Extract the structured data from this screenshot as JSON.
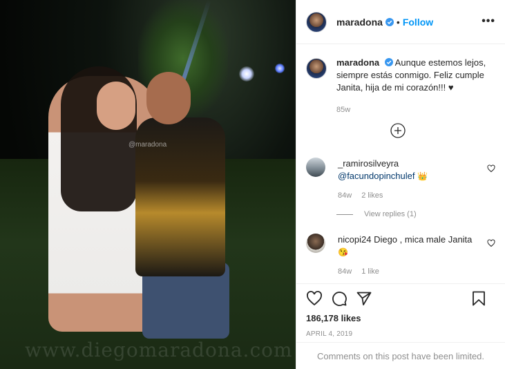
{
  "header": {
    "username": "maradona",
    "separator": "•",
    "follow_label": "Follow",
    "more_label": "•••"
  },
  "caption": {
    "username": "maradona",
    "text": "Aunque estemos lejos, siempre estás conmigo. Feliz cumple Janita, hija de mi corazón!!! ♥",
    "age": "85w"
  },
  "photo": {
    "tag_text": "@maradona",
    "watermark": "www.diegomaradona.com"
  },
  "comments": [
    {
      "username": "_ramirosilveyra",
      "mention": "@facundopinchulef",
      "emoji": "👑",
      "age": "84w",
      "likes": "2 likes",
      "view_replies": "View replies (1)"
    },
    {
      "username": "nicopi24",
      "text": "Diego , mica male Janita",
      "emoji": "😘",
      "age": "84w",
      "likes": "1 like"
    }
  ],
  "actions": {
    "likes_count": "186,178 likes",
    "date": "APRIL 4, 2019",
    "comments_limited": "Comments on this post have been limited."
  },
  "colors": {
    "accent": "#0095f6",
    "verified": "#3897f0",
    "muted": "#8e8e8e"
  },
  "icons": [
    "verified-badge-icon",
    "more-options-icon",
    "add-comments-icon",
    "heart-icon",
    "comment-icon",
    "share-icon",
    "bookmark-icon"
  ]
}
